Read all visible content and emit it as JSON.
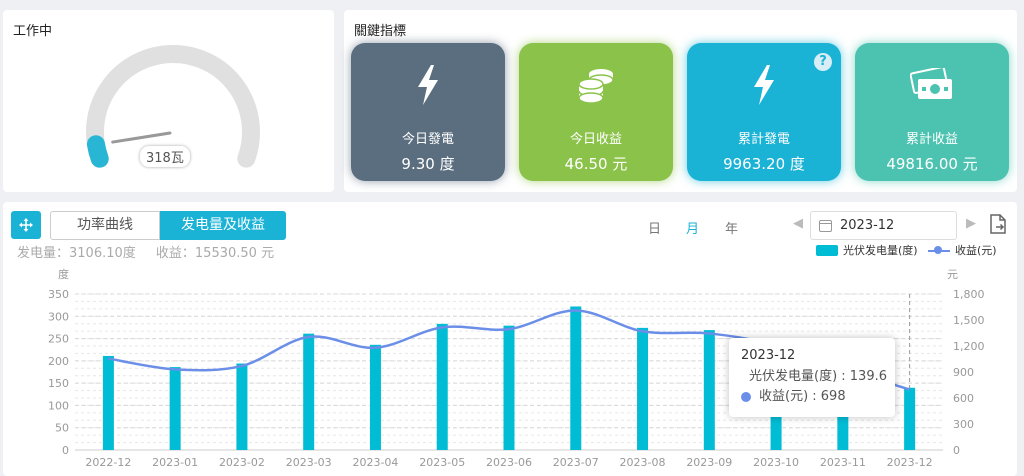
{
  "gauge": {
    "title": "工作中",
    "value_label": "318瓦",
    "level": 0.05,
    "colors": {
      "track": "#e0e0e0",
      "fill": "#29b6d4",
      "needle": "#999999"
    }
  },
  "kpi": {
    "title": "關鍵指標",
    "cards": [
      {
        "label": "今日發電",
        "value": "9.30 度",
        "icon": "lightning-icon",
        "color": "#5b6e7f"
      },
      {
        "label": "今日收益",
        "value": "46.50 元",
        "icon": "coins-icon",
        "color": "#8bc34a"
      },
      {
        "label": "累計發電",
        "value": "9963.20 度",
        "icon": "lightning-icon",
        "color": "#1ab2d5",
        "help": "?"
      },
      {
        "label": "累計收益",
        "value": "49816.00 元",
        "icon": "cash-icon",
        "color": "#4cc3b0"
      }
    ]
  },
  "chart_panel": {
    "tabs": [
      "功率曲线",
      "发电量及收益"
    ],
    "active_tab": 1,
    "periods": [
      "日",
      "月",
      "年"
    ],
    "selected_period": "月",
    "date_value": "2023-12",
    "prev_arrow": "◀",
    "next_arrow": "▶",
    "summary_energy": "发电量：3106.10度",
    "summary_income": "收益：15530.50 元",
    "legend": [
      "光伏发电量(度)",
      "收益(元)"
    ]
  },
  "tooltip": {
    "title": "2023-12",
    "rows": [
      "光伏发电量(度) : 139.6",
      "收益(元) : 698"
    ]
  },
  "chart_data": {
    "type": "bar",
    "categories": [
      "2022-12",
      "2023-01",
      "2023-02",
      "2023-03",
      "2023-04",
      "2023-05",
      "2023-06",
      "2023-07",
      "2023-08",
      "2023-09",
      "2023-10",
      "2023-11",
      "2023-12"
    ],
    "series": [
      {
        "name": "光伏发电量(度)",
        "type": "bar",
        "axis": "left",
        "color": "#00bcd4",
        "values": [
          211,
          186,
          194,
          261,
          236,
          283,
          279,
          322,
          274,
          269,
          195,
          150,
          139.6
        ]
      },
      {
        "name": "收益(元)",
        "type": "line",
        "axis": "right",
        "color": "#6b8fe8",
        "values": [
          1055,
          930,
          970,
          1305,
          1180,
          1415,
          1395,
          1610,
          1370,
          1345,
          1210,
          940,
          698
        ]
      }
    ],
    "ylabel_left": "度",
    "ylabel_right": "元",
    "ylim_left": [
      0,
      350
    ],
    "yticks_left": [
      0,
      50,
      100,
      150,
      200,
      250,
      300,
      350
    ],
    "ylim_right": [
      0,
      1800
    ],
    "yticks_right": [
      0,
      300,
      600,
      900,
      1200,
      1500,
      1800
    ],
    "yticklabels_right": [
      "0",
      "300",
      "600",
      "900",
      "1,200",
      "1,500",
      "1,800"
    ],
    "grid": true,
    "legend_position": "top-right",
    "highlighted_category": "2023-12"
  }
}
